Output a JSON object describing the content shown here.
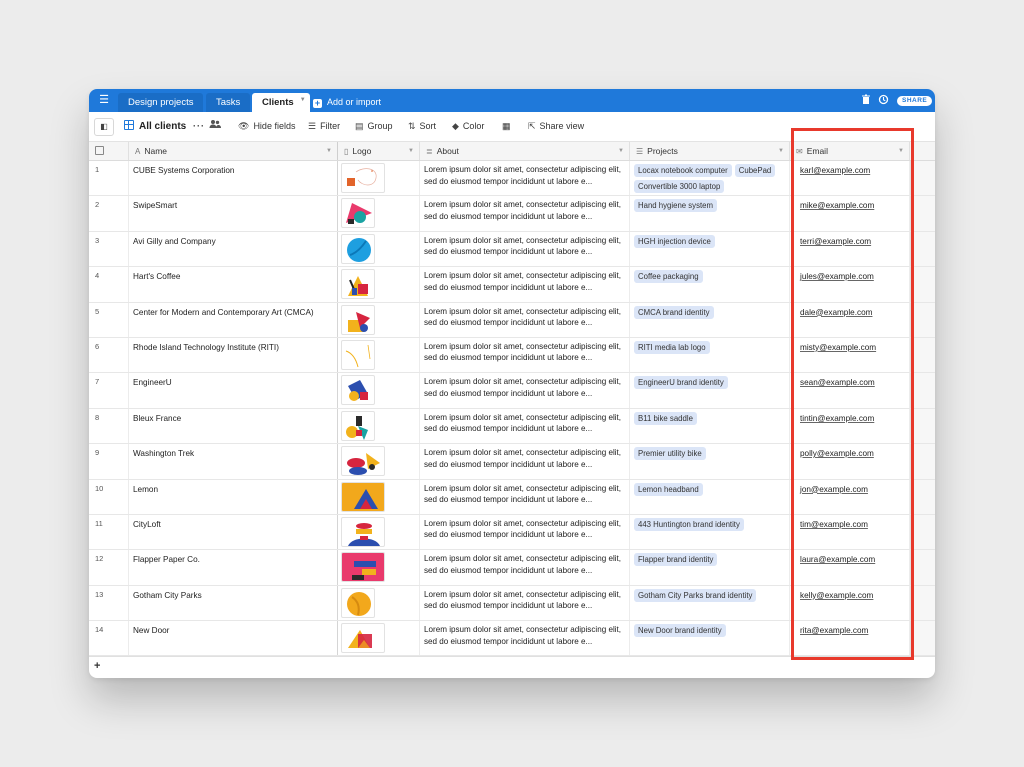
{
  "tabs": [
    {
      "label": "Design projects",
      "active": false
    },
    {
      "label": "Tasks",
      "active": false
    },
    {
      "label": "Clients",
      "active": true
    }
  ],
  "add_import_label": "Add or import",
  "share_label": "SHARE",
  "toolbar": {
    "view_name": "All clients",
    "hide_fields": "Hide fields",
    "filter": "Filter",
    "group": "Group",
    "sort": "Sort",
    "color": "Color",
    "share_view": "Share view"
  },
  "columns": {
    "name": "Name",
    "logo": "Logo",
    "about": "About",
    "projects": "Projects",
    "email": "Email"
  },
  "about_text": "Lorem ipsum dolor sit amet, consectetur adipiscing elit, sed do eiusmod tempor incididunt ut labore e...",
  "rows": [
    {
      "num": "1",
      "name": "CUBE Systems Corporation",
      "projects": [
        "Locax notebook computer",
        "CubePad",
        "Convertible 3000 laptop"
      ],
      "email": "karl@example.com",
      "logo": "logo-1"
    },
    {
      "num": "2",
      "name": "SwipeSmart",
      "projects": [
        "Hand hygiene system"
      ],
      "email": "mike@example.com",
      "logo": "logo-2"
    },
    {
      "num": "3",
      "name": "Avi Gilly and Company",
      "projects": [
        "HGH injection device"
      ],
      "email": "terri@example.com",
      "logo": "logo-3"
    },
    {
      "num": "4",
      "name": "Hart's Coffee",
      "projects": [
        "Coffee packaging"
      ],
      "email": "jules@example.com",
      "logo": "logo-4"
    },
    {
      "num": "5",
      "name": "Center for Modern and Contemporary Art (CMCA)",
      "projects": [
        "CMCA brand identity"
      ],
      "email": "dale@example.com",
      "logo": "logo-5"
    },
    {
      "num": "6",
      "name": "Rhode Island Technology Institute (RITI)",
      "projects": [
        "RITI media lab logo"
      ],
      "email": "misty@example.com",
      "logo": "logo-6"
    },
    {
      "num": "7",
      "name": "EngineerU",
      "projects": [
        "EngineerU brand identity"
      ],
      "email": "sean@example.com",
      "logo": "logo-7"
    },
    {
      "num": "8",
      "name": "Bleux France",
      "projects": [
        "B11 bike saddle"
      ],
      "email": "tintin@example.com",
      "logo": "logo-8"
    },
    {
      "num": "9",
      "name": "Washington Trek",
      "projects": [
        "Premier utility bike"
      ],
      "email": "polly@example.com",
      "logo": "logo-9"
    },
    {
      "num": "10",
      "name": "Lemon",
      "projects": [
        "Lemon headband"
      ],
      "email": "jon@example.com",
      "logo": "logo-10"
    },
    {
      "num": "11",
      "name": "CityLoft",
      "projects": [
        "443 Huntington brand identity"
      ],
      "email": "tim@example.com",
      "logo": "logo-11"
    },
    {
      "num": "12",
      "name": "Flapper Paper Co.",
      "projects": [
        "Flapper brand identity"
      ],
      "email": "laura@example.com",
      "logo": "logo-12"
    },
    {
      "num": "13",
      "name": "Gotham City Parks",
      "projects": [
        "Gotham City Parks brand identity"
      ],
      "email": "kelly@example.com",
      "logo": "logo-13"
    },
    {
      "num": "14",
      "name": "New Door",
      "projects": [
        "New Door brand identity"
      ],
      "email": "rita@example.com",
      "logo": "logo-14"
    }
  ],
  "colors": {
    "brand_blue": "#1f79da",
    "chip_bg": "#dbe5f7",
    "highlight_red": "#e8392c"
  }
}
